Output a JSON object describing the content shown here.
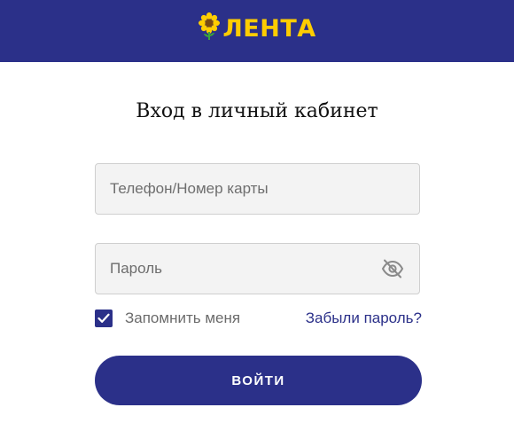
{
  "header": {
    "logo_text": "ЛЕНТА",
    "background_color": "#2b3089",
    "logo_color": "#ffcd00",
    "logo_icon": "sunflower-icon"
  },
  "form": {
    "title": "Вход в личный кабинет",
    "phone_placeholder": "Телефон/Номер карты",
    "phone_value": "",
    "password_placeholder": "Пароль",
    "password_value": "",
    "password_toggle_icon": "eye-slash-icon",
    "remember_label": "Запомнить меня",
    "remember_checked": true,
    "forgot_label": "Забыли пароль?",
    "submit_label": "ВОЙТИ",
    "accent_color": "#2b3089"
  }
}
